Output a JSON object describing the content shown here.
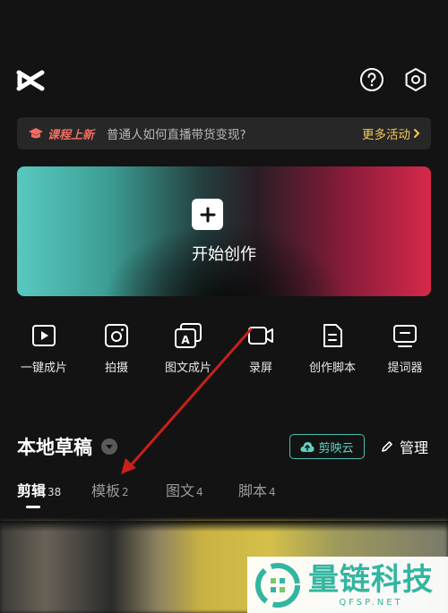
{
  "promo": {
    "badge": "课程上新",
    "text": "普通人如何直播带货变现?",
    "more": "更多活动"
  },
  "hero": {
    "label": "开始创作"
  },
  "tools": [
    {
      "label": "一键成片",
      "icon": "play-icon"
    },
    {
      "label": "拍摄",
      "icon": "camera-icon"
    },
    {
      "label": "图文成片",
      "icon": "image-text-icon"
    },
    {
      "label": "录屏",
      "icon": "video-record-icon"
    },
    {
      "label": "创作脚本",
      "icon": "script-icon"
    },
    {
      "label": "提词器",
      "icon": "teleprompter-icon"
    }
  ],
  "drafts": {
    "title": "本地草稿",
    "cloud": "剪映云",
    "manage": "管理",
    "tabs": [
      {
        "label": "剪辑",
        "count": "38"
      },
      {
        "label": "模板",
        "count": "2"
      },
      {
        "label": "图文",
        "count": "4"
      },
      {
        "label": "脚本",
        "count": "4"
      }
    ]
  },
  "watermark": {
    "title": "量链科技",
    "sub": "QFSP.NET"
  },
  "colors": {
    "accent_teal": "#4cc0b0",
    "promo_gold": "#f2c85a",
    "promo_red": "#ee6d64",
    "annotation_arrow": "#c8201c"
  }
}
